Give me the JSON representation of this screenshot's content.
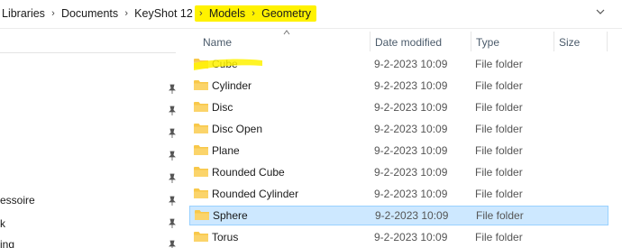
{
  "breadcrumb": {
    "items": [
      "Libraries",
      "Documents",
      "KeyShot 12",
      "Models",
      "Geometry"
    ]
  },
  "nav": {
    "labels": [
      "essoire",
      "k",
      "ing"
    ]
  },
  "columns": {
    "name": "Name",
    "date": "Date modified",
    "type": "Type",
    "size": "Size"
  },
  "files": [
    {
      "name": "Cube",
      "date": "9-2-2023 10:09",
      "type": "File folder"
    },
    {
      "name": "Cylinder",
      "date": "9-2-2023 10:09",
      "type": "File folder"
    },
    {
      "name": "Disc",
      "date": "9-2-2023 10:09",
      "type": "File folder"
    },
    {
      "name": "Disc Open",
      "date": "9-2-2023 10:09",
      "type": "File folder"
    },
    {
      "name": "Plane",
      "date": "9-2-2023 10:09",
      "type": "File folder"
    },
    {
      "name": "Rounded Cube",
      "date": "9-2-2023 10:09",
      "type": "File folder"
    },
    {
      "name": "Rounded Cylinder",
      "date": "9-2-2023 10:09",
      "type": "File folder"
    },
    {
      "name": "Sphere",
      "date": "9-2-2023 10:09",
      "type": "File folder",
      "selected": true
    },
    {
      "name": "Torus",
      "date": "9-2-2023 10:09",
      "type": "File folder"
    }
  ],
  "colors": {
    "highlight": "#fff200",
    "selection": "#cde8ff",
    "selection_border": "#99d1ff",
    "folder": "#f8c84a"
  },
  "icons": [
    "chevron-right-icon",
    "chevron-down-icon",
    "pin-icon",
    "folder-icon",
    "sort-up-icon"
  ]
}
